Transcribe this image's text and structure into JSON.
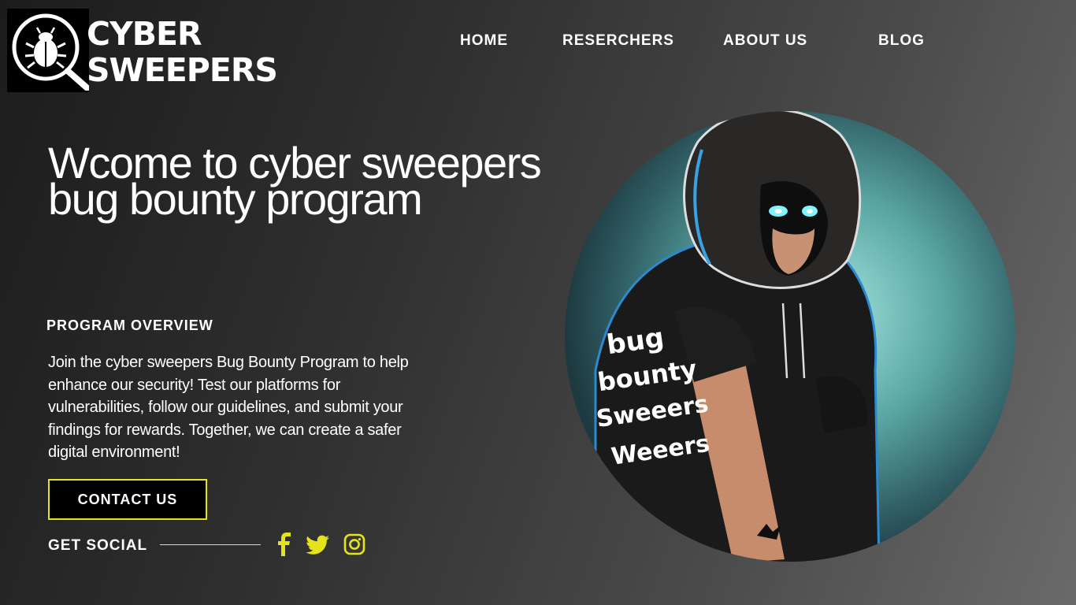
{
  "brand": {
    "line1": "CYBER",
    "line2": "SWEEPERS",
    "logo_icon": "bug-magnifier-icon"
  },
  "nav": {
    "items": [
      {
        "label": "HOME"
      },
      {
        "label": "RESERCHERS"
      },
      {
        "label": "ABOUT US"
      },
      {
        "label": "BLOG"
      }
    ]
  },
  "hero": {
    "title": "Wcome to cyber sweepers bug bounty program",
    "overview_heading": "PROGRAM OVERVIEW",
    "overview_text": "Join the cyber sweepers Bug Bounty Program to help enhance our security! Test our platforms for vulnerabilities, follow our guidelines, and submit your findings for rewards. Together, we can create a safer digital environment!",
    "contact_label": "CONTACT US",
    "shirt_text": [
      "bug",
      "bounty",
      "Sweeers",
      "Weeers"
    ]
  },
  "social": {
    "label": "GET SOCIAL",
    "icons": [
      "facebook-icon",
      "twitter-icon",
      "instagram-icon"
    ]
  },
  "colors": {
    "accent": "#e6e31a",
    "text": "#ffffff",
    "background_dark": "#1c1c1c",
    "background_light": "#6a6a6a",
    "circle_glow": "#7cc6c2"
  }
}
